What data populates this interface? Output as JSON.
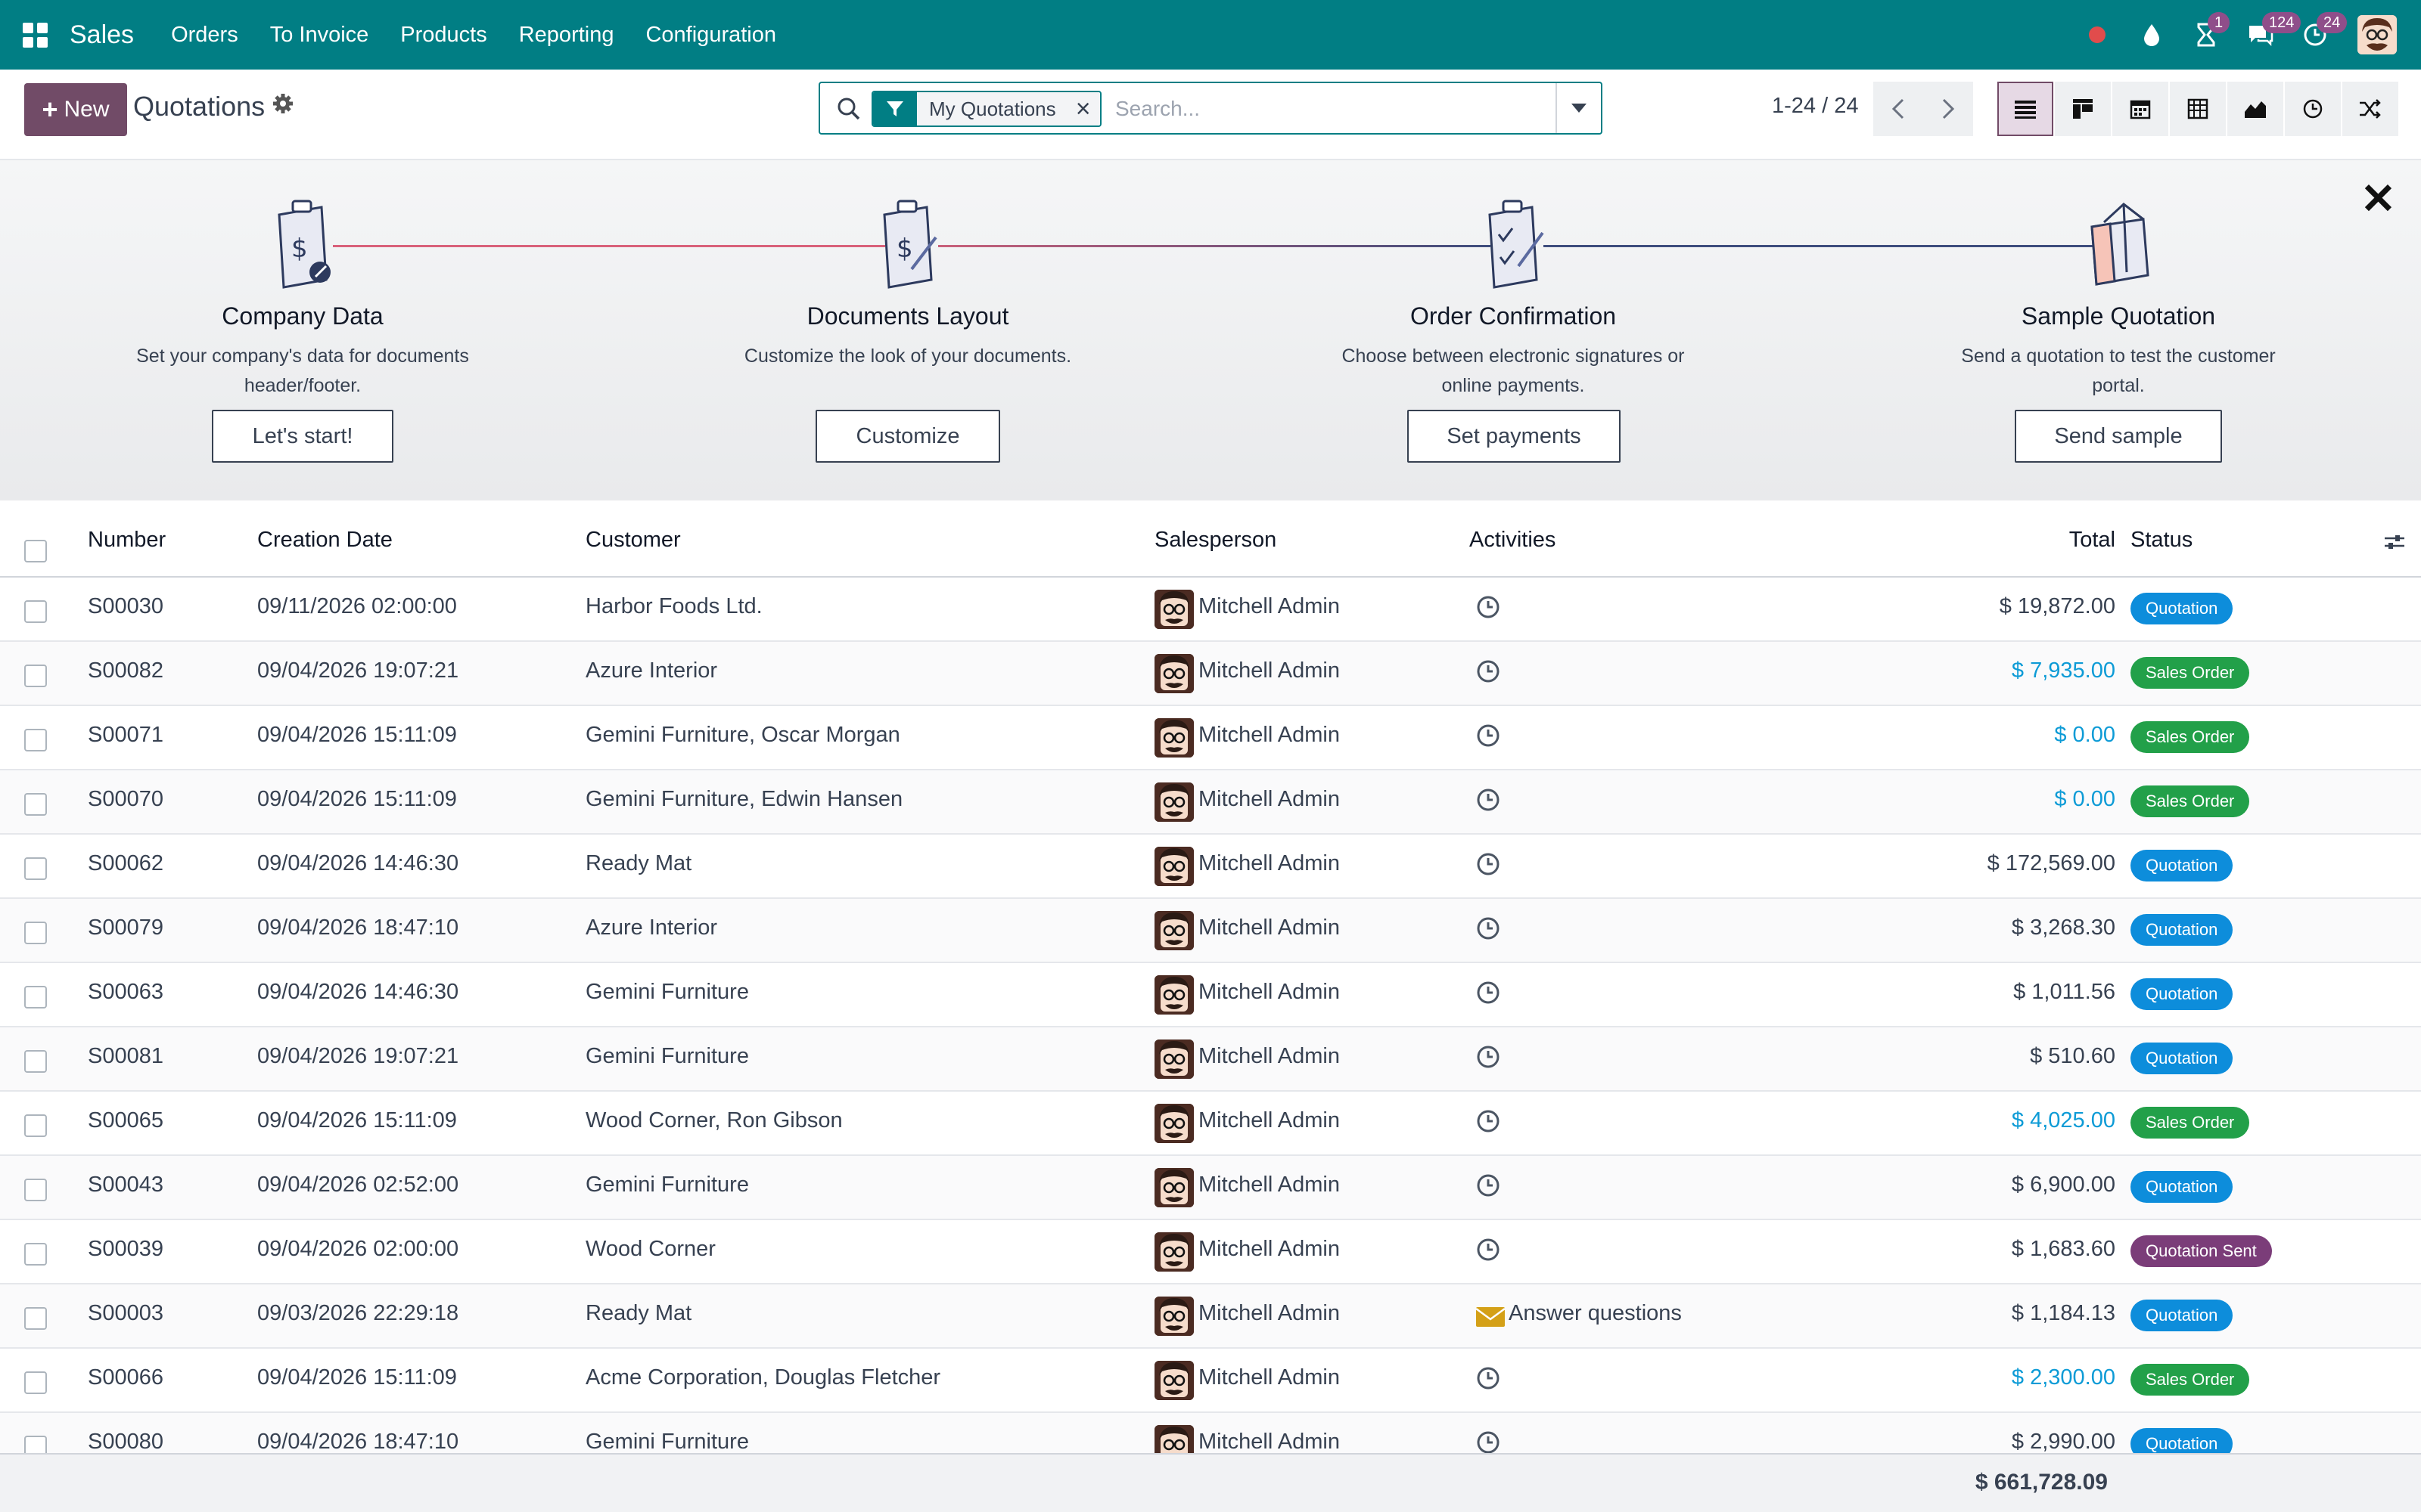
{
  "navbar": {
    "brand": "Sales",
    "menu": [
      "Orders",
      "To Invoice",
      "Products",
      "Reporting",
      "Configuration"
    ],
    "badges": {
      "activities": "1",
      "messages": "124",
      "updates": "24"
    },
    "accent_color": "#017e84"
  },
  "control": {
    "new_label": "New",
    "title": "Quotations",
    "facet_label": "My Quotations",
    "search_placeholder": "Search...",
    "pager": "1-24 / 24"
  },
  "onboarding": {
    "steps": [
      {
        "title": "Company Data",
        "description": "Set your company's data for documents header/footer.",
        "button": "Let's start!"
      },
      {
        "title": "Documents Layout",
        "description": "Customize the look of your documents.",
        "button": "Customize"
      },
      {
        "title": "Order Confirmation",
        "description": "Choose between electronic signatures or online payments.",
        "button": "Set payments"
      },
      {
        "title": "Sample Quotation",
        "description": "Send a quotation to test the customer portal.",
        "button": "Send sample"
      }
    ]
  },
  "table": {
    "headers": {
      "number": "Number",
      "date": "Creation Date",
      "customer": "Customer",
      "salesperson": "Salesperson",
      "activities": "Activities",
      "total": "Total",
      "status": "Status"
    },
    "rows": [
      {
        "number": "S00030",
        "date": "09/11/2026 02:00:00",
        "customer": "Harbor Foods Ltd.",
        "salesperson": "Mitchell Admin",
        "activity": "",
        "total": "$ 19,872.00",
        "status": "Quotation",
        "status_kind": "quotation",
        "total_link": false
      },
      {
        "number": "S00082",
        "date": "09/04/2026 19:07:21",
        "customer": "Azure Interior",
        "salesperson": "Mitchell Admin",
        "activity": "",
        "total": "$ 7,935.00",
        "status": "Sales Order",
        "status_kind": "sales",
        "total_link": true
      },
      {
        "number": "S00071",
        "date": "09/04/2026 15:11:09",
        "customer": "Gemini Furniture, Oscar Morgan",
        "salesperson": "Mitchell Admin",
        "activity": "",
        "total": "$ 0.00",
        "status": "Sales Order",
        "status_kind": "sales",
        "total_link": true
      },
      {
        "number": "S00070",
        "date": "09/04/2026 15:11:09",
        "customer": "Gemini Furniture, Edwin Hansen",
        "salesperson": "Mitchell Admin",
        "activity": "",
        "total": "$ 0.00",
        "status": "Sales Order",
        "status_kind": "sales",
        "total_link": true
      },
      {
        "number": "S00062",
        "date": "09/04/2026 14:46:30",
        "customer": "Ready Mat",
        "salesperson": "Mitchell Admin",
        "activity": "",
        "total": "$ 172,569.00",
        "status": "Quotation",
        "status_kind": "quotation",
        "total_link": false
      },
      {
        "number": "S00079",
        "date": "09/04/2026 18:47:10",
        "customer": "Azure Interior",
        "salesperson": "Mitchell Admin",
        "activity": "",
        "total": "$ 3,268.30",
        "status": "Quotation",
        "status_kind": "quotation",
        "total_link": false
      },
      {
        "number": "S00063",
        "date": "09/04/2026 14:46:30",
        "customer": "Gemini Furniture",
        "salesperson": "Mitchell Admin",
        "activity": "",
        "total": "$ 1,011.56",
        "status": "Quotation",
        "status_kind": "quotation",
        "total_link": false
      },
      {
        "number": "S00081",
        "date": "09/04/2026 19:07:21",
        "customer": "Gemini Furniture",
        "salesperson": "Mitchell Admin",
        "activity": "",
        "total": "$ 510.60",
        "status": "Quotation",
        "status_kind": "quotation",
        "total_link": false
      },
      {
        "number": "S00065",
        "date": "09/04/2026 15:11:09",
        "customer": "Wood Corner, Ron Gibson",
        "salesperson": "Mitchell Admin",
        "activity": "",
        "total": "$ 4,025.00",
        "status": "Sales Order",
        "status_kind": "sales",
        "total_link": true
      },
      {
        "number": "S00043",
        "date": "09/04/2026 02:52:00",
        "customer": "Gemini Furniture",
        "salesperson": "Mitchell Admin",
        "activity": "",
        "total": "$ 6,900.00",
        "status": "Quotation",
        "status_kind": "quotation",
        "total_link": false
      },
      {
        "number": "S00039",
        "date": "09/04/2026 02:00:00",
        "customer": "Wood Corner",
        "salesperson": "Mitchell Admin",
        "activity": "",
        "total": "$ 1,683.60",
        "status": "Quotation Sent",
        "status_kind": "sent",
        "total_link": false
      },
      {
        "number": "S00003",
        "date": "09/03/2026 22:29:18",
        "customer": "Ready Mat",
        "salesperson": "Mitchell Admin",
        "activity": "Answer questions",
        "total": "$ 1,184.13",
        "status": "Quotation",
        "status_kind": "quotation",
        "total_link": false
      },
      {
        "number": "S00066",
        "date": "09/04/2026 15:11:09",
        "customer": "Acme Corporation, Douglas Fletcher",
        "salesperson": "Mitchell Admin",
        "activity": "",
        "total": "$ 2,300.00",
        "status": "Sales Order",
        "status_kind": "sales",
        "total_link": true
      },
      {
        "number": "S00080",
        "date": "09/04/2026 18:47:10",
        "customer": "Gemini Furniture",
        "salesperson": "Mitchell Admin",
        "activity": "",
        "total": "$ 2,990.00",
        "status": "Quotation",
        "status_kind": "quotation",
        "total_link": false
      }
    ],
    "grand_total": "$ 661,728.09"
  }
}
